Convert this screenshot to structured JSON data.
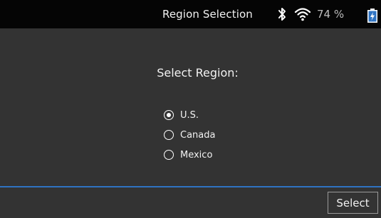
{
  "header": {
    "title": "Region Selection",
    "battery_percent": "74 %",
    "icons": [
      "bluetooth-icon",
      "wifi-icon",
      "battery-charging-icon"
    ]
  },
  "main": {
    "prompt": "Select Region:",
    "options": [
      {
        "label": "U.S.",
        "selected": true
      },
      {
        "label": "Canada",
        "selected": false
      },
      {
        "label": "Mexico",
        "selected": false
      }
    ]
  },
  "footer": {
    "select_label": "Select"
  },
  "colors": {
    "background": "#333333",
    "header": "#050505",
    "accent": "#2f73c2"
  }
}
